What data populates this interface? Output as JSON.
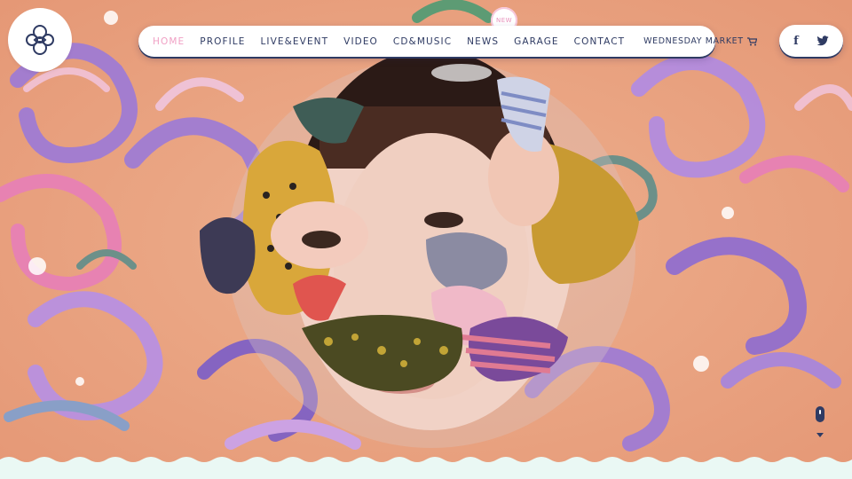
{
  "logo": {
    "icon": "flower-knot-logo-icon"
  },
  "nav": {
    "items": [
      {
        "label": "HOME",
        "active": true
      },
      {
        "label": "PROFILE",
        "active": false
      },
      {
        "label": "LIVE&EVENT",
        "active": false
      },
      {
        "label": "VIDEO",
        "active": false
      },
      {
        "label": "CD&MUSIC",
        "active": false
      },
      {
        "label": "NEWS",
        "active": false
      },
      {
        "label": "GARAGE",
        "active": false
      },
      {
        "label": "CONTACT",
        "active": false
      }
    ],
    "shop_label": "WEDNESDAY MARKET",
    "shop_icon": "cart-icon",
    "new_badge": "NEW"
  },
  "social": {
    "facebook": "f",
    "twitter_icon": "twitter-bird-icon"
  },
  "colors": {
    "navy": "#2f3b63",
    "active_pink": "#f0a0c4",
    "background_peach": "#e9a27e",
    "purple": "#9c7ad8",
    "pink": "#e77fb8",
    "mint": "#eaf8f4"
  },
  "hero": {
    "image": "collage-portrait-with-patterned-shapes"
  }
}
